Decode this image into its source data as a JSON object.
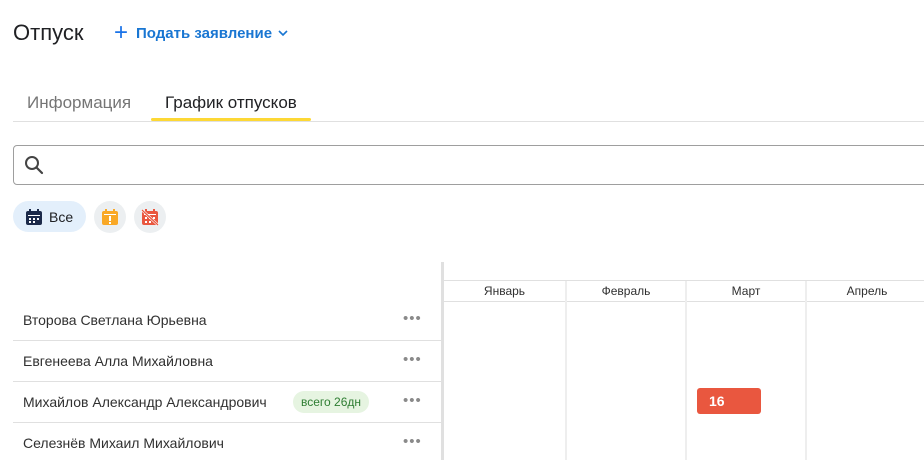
{
  "header": {
    "title": "Отпуск",
    "new_application_label": "Подать заявление"
  },
  "tabs": [
    {
      "label": "Информация",
      "active": false
    },
    {
      "label": "График отпусков",
      "active": true
    }
  ],
  "search": {
    "value": "",
    "placeholder": ""
  },
  "filters": [
    {
      "label": "Все",
      "icon": "calendar-icon",
      "selected": true
    },
    {
      "label": "",
      "icon": "calendar-pending-icon",
      "selected": false
    },
    {
      "label": "",
      "icon": "calendar-rejected-icon",
      "selected": false
    }
  ],
  "employees": [
    {
      "name": "Второва Светлана Юрьевна",
      "badge": ""
    },
    {
      "name": "Евгенеева Алла Михайловна",
      "badge": ""
    },
    {
      "name": "Михайлов Александр Александрович",
      "badge": "всего 26дн"
    },
    {
      "name": "Селезнёв Михаил Михайлович",
      "badge": ""
    }
  ],
  "calendar": {
    "months": [
      "Январь",
      "Февраль",
      "Март",
      "Апрель"
    ],
    "vacations": [
      {
        "employee_index": 2,
        "month": "Март",
        "label": "16"
      }
    ]
  },
  "colors": {
    "accent": "#1976d2",
    "tab_underline": "#fdd835",
    "vacation_bar": "#e9573f",
    "badge_bg": "#e6f4e1",
    "badge_text": "#2e7d32"
  }
}
